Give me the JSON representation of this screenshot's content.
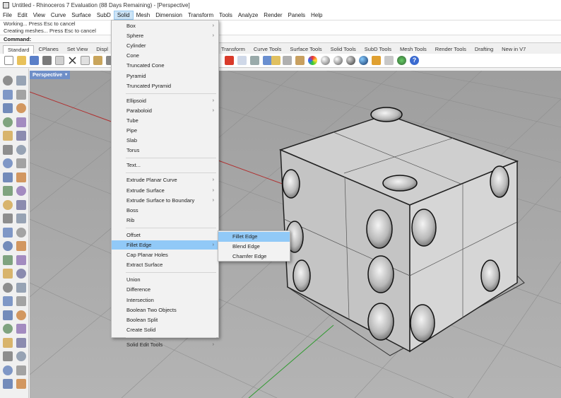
{
  "window": {
    "title": "Untitled - Rhinoceros 7 Evaluation (88 Days Remaining) - [Perspective]"
  },
  "menubar": [
    "File",
    "Edit",
    "View",
    "Curve",
    "Surface",
    "SubD",
    "Solid",
    "Mesh",
    "Dimension",
    "Transform",
    "Tools",
    "Analyze",
    "Render",
    "Panels",
    "Help"
  ],
  "command": {
    "history": [
      "Working... Press Esc to cancel",
      "Creating meshes... Press Esc to cancel"
    ],
    "prompt": "Command:"
  },
  "toolbar_tabs": [
    "Standard",
    "CPlanes",
    "Set View",
    "Displ",
    "Transform",
    "Curve Tools",
    "Surface Tools",
    "Solid Tools",
    "SubD Tools",
    "Mesh Tools",
    "Render Tools",
    "Drafting",
    "New in V7"
  ],
  "viewport": {
    "label": "Perspective"
  },
  "solid_menu": [
    {
      "label": "Box",
      "sub": true
    },
    {
      "label": "Sphere",
      "sub": true
    },
    {
      "label": "Cylinder"
    },
    {
      "label": "Cone"
    },
    {
      "label": "Truncated Cone"
    },
    {
      "label": "Pyramid"
    },
    {
      "label": "Truncated Pyramid"
    },
    {
      "sep": true
    },
    {
      "label": "Ellipsoid",
      "sub": true
    },
    {
      "label": "Paraboloid",
      "sub": true
    },
    {
      "label": "Tube"
    },
    {
      "label": "Pipe"
    },
    {
      "label": "Slab"
    },
    {
      "label": "Torus"
    },
    {
      "sep": true
    },
    {
      "label": "Text..."
    },
    {
      "sep": true
    },
    {
      "label": "Extrude Planar Curve",
      "sub": true
    },
    {
      "label": "Extrude Surface",
      "sub": true
    },
    {
      "label": "Extrude Surface to Boundary",
      "sub": true
    },
    {
      "label": "Boss"
    },
    {
      "label": "Rib"
    },
    {
      "sep": true
    },
    {
      "label": "Offset"
    },
    {
      "label": "Fillet Edge",
      "sub": true,
      "hl": true
    },
    {
      "label": "Cap Planar Holes"
    },
    {
      "label": "Extract Surface"
    },
    {
      "sep": true
    },
    {
      "label": "Union"
    },
    {
      "label": "Difference"
    },
    {
      "label": "Intersection"
    },
    {
      "label": "Boolean Two Objects"
    },
    {
      "label": "Boolean Split"
    },
    {
      "label": "Create Solid"
    },
    {
      "sep": true
    },
    {
      "label": "Solid Edit Tools",
      "sub": true
    }
  ],
  "fillet_submenu": [
    {
      "label": "Fillet Edge",
      "hl": true
    },
    {
      "label": "Blend Edge"
    },
    {
      "label": "Chamfer Edge"
    }
  ],
  "icons": {
    "submenu_arrow": "›",
    "viewport_caret": "▾"
  }
}
